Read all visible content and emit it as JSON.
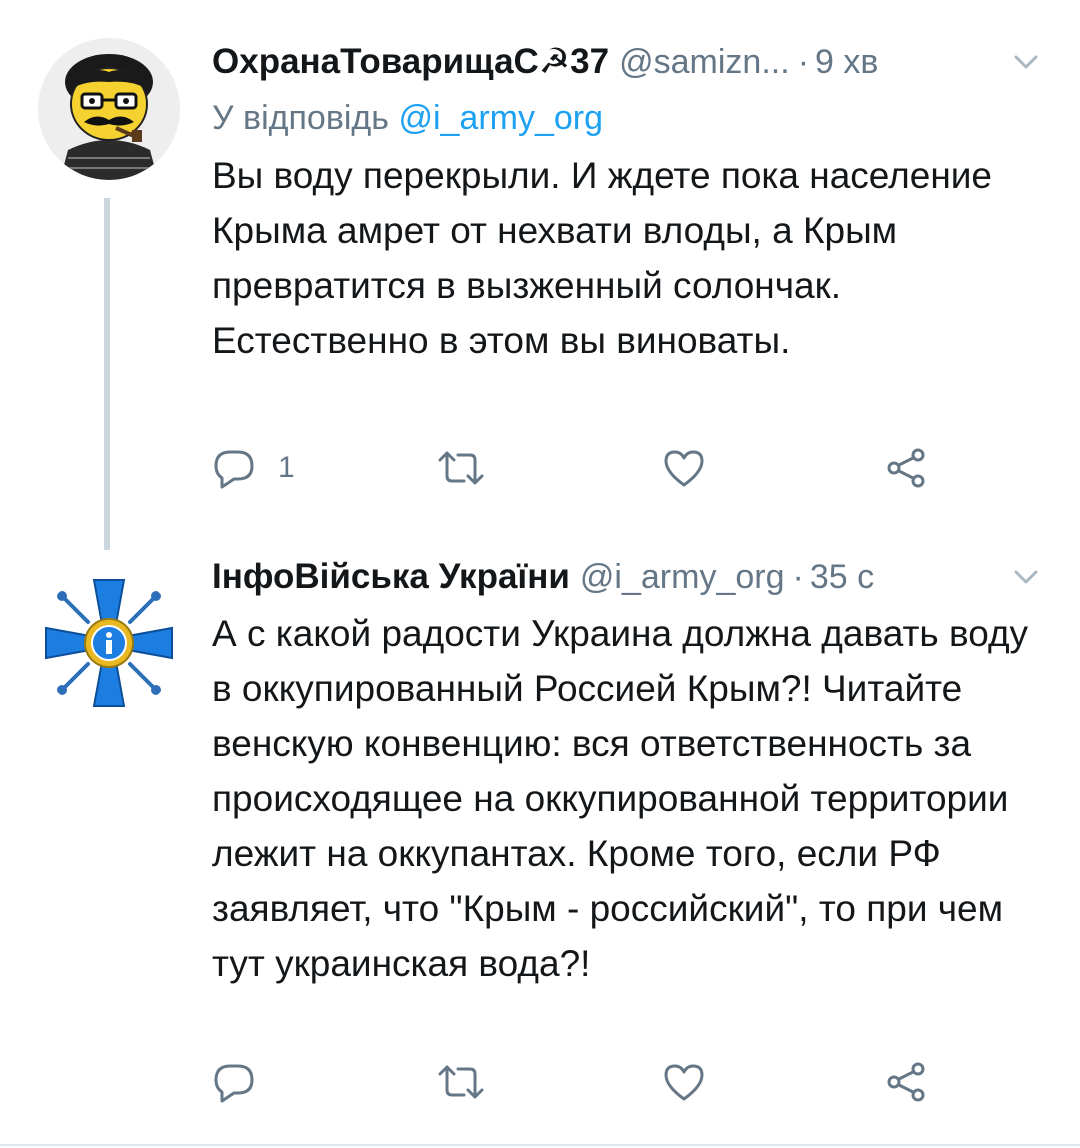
{
  "colors": {
    "text": "#14171a",
    "secondary": "#657786",
    "link": "#1da1f2",
    "thread_line": "#ccd6dd"
  },
  "tweets": [
    {
      "display_name": "ОхранаТоварищаС☭37",
      "handle": "@samizn...",
      "dot": "·",
      "time": "9 хв",
      "reply_prefix": "У відповідь",
      "reply_mention": "@i_army_org",
      "text": "Вы воду перекрыли. И ждете пока население Крыма амрет от нехвати влоды, а Крым превратится в вызженный солончак. Естественно в этом вы виноваты.",
      "reply_count": "1",
      "icons": [
        "reply-icon",
        "retweet-icon",
        "like-icon",
        "share-icon",
        "chevron-down-icon"
      ]
    },
    {
      "display_name": "ІнфоВійська України",
      "handle": "@i_army_org",
      "dot": "·",
      "time": "35 с",
      "text": "А с какой радости Украина должна давать воду в оккупированный Россией Крым?! Читайте венскую конвенцию: вся ответственность за происходящее на оккупированной территории лежит на оккупантах. Кроме того, если РФ заявляет, что \"Крым - российский\", то при чем тут украинская вода?!",
      "reply_count": "",
      "icons": [
        "reply-icon",
        "retweet-icon",
        "like-icon",
        "share-icon",
        "chevron-down-icon"
      ]
    }
  ]
}
